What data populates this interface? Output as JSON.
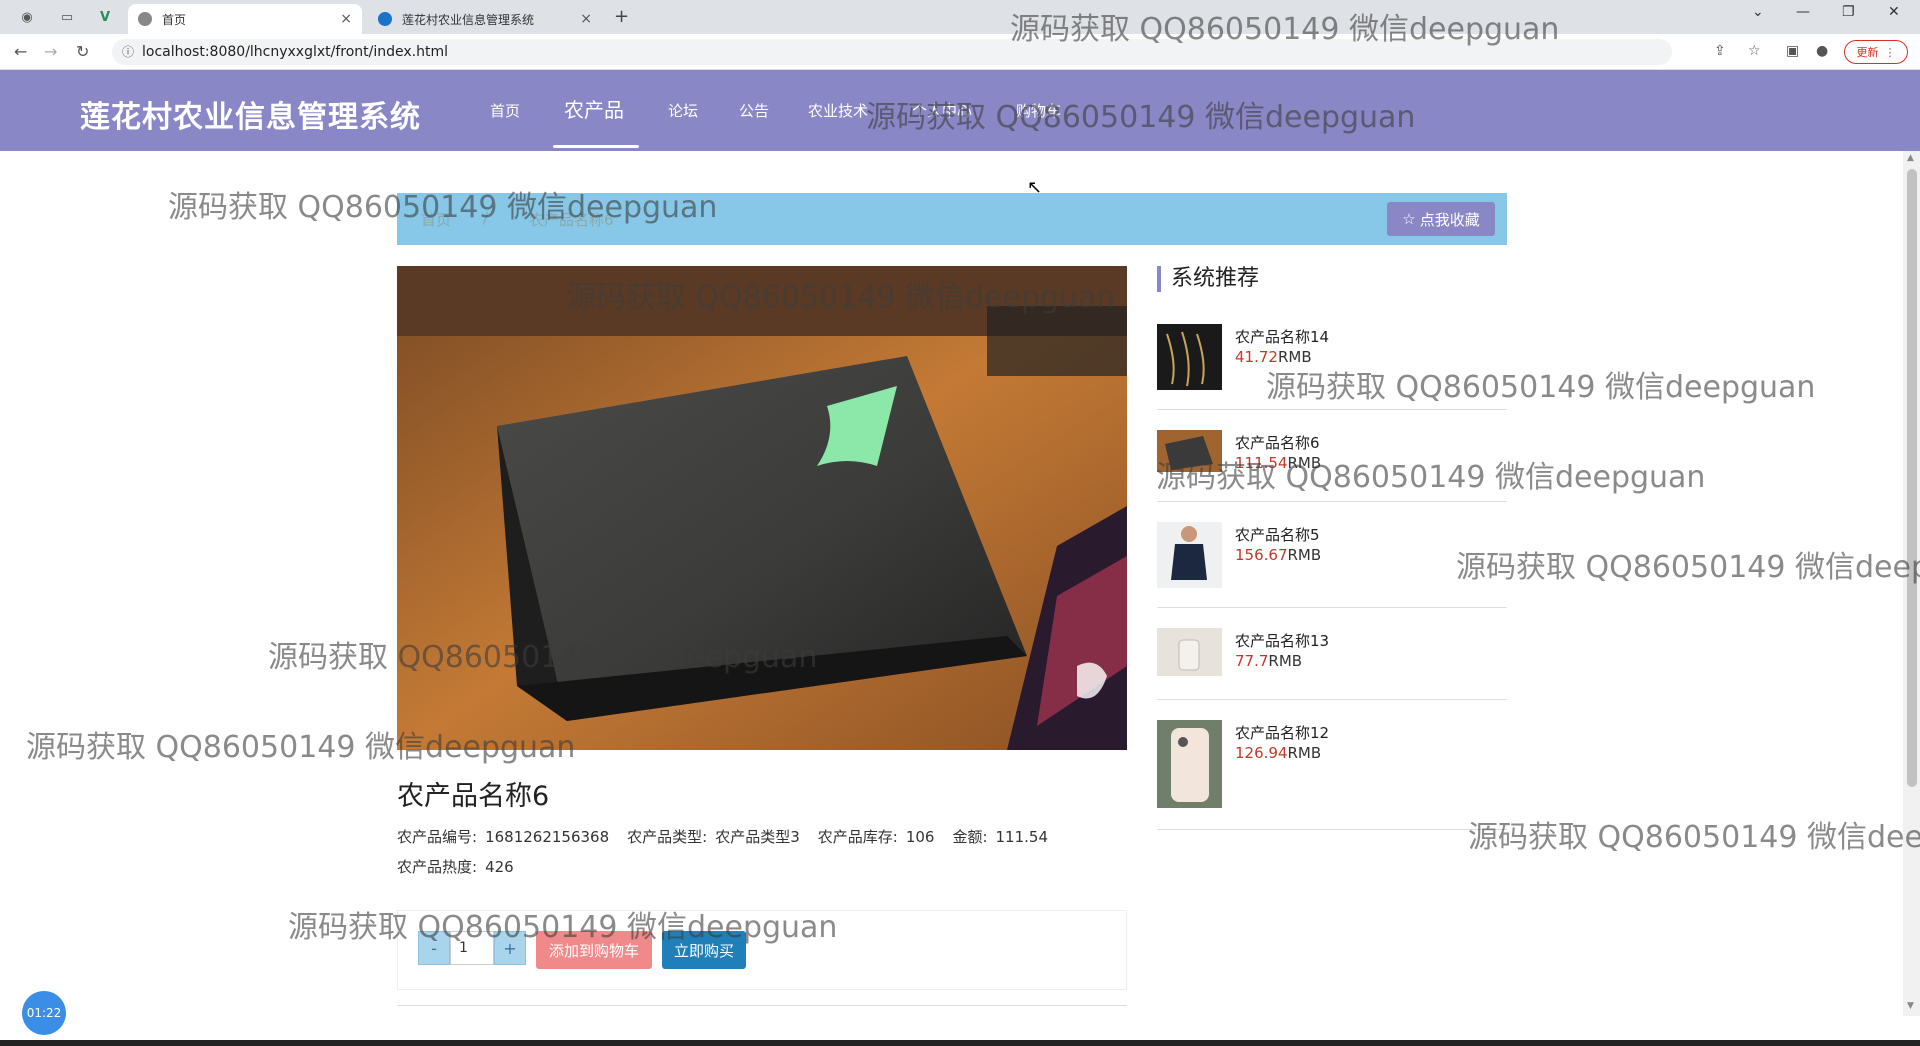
{
  "browser": {
    "tabs": [
      {
        "title": "首页",
        "close": "×"
      },
      {
        "title": "莲花村农业信息管理系统",
        "close": "×"
      }
    ],
    "new_tab": "+",
    "url": "localhost:8080/lhcnyxxglxt/front/index.html",
    "update_label": "更新",
    "window_controls": [
      "⌄",
      "—",
      "❐",
      "✕"
    ]
  },
  "site": {
    "brand": "莲花村农业信息管理系统",
    "nav": [
      "首页",
      "农产品",
      "论坛",
      "公告",
      "农业技术",
      "个人中心",
      "购物车"
    ],
    "active_nav": "农产品"
  },
  "breadcrumb": {
    "home": "首页",
    "separator": "/",
    "current": "农产品名称6",
    "favorite_label": "点我收藏"
  },
  "product": {
    "name": "农产品名称6",
    "fields": [
      {
        "label": "农产品编号:",
        "value": "1681262156368"
      },
      {
        "label": "农产品类型:",
        "value": "农产品类型3"
      },
      {
        "label": "农产品库存:",
        "value": "106"
      },
      {
        "label": "金额:",
        "value": "111.54"
      },
      {
        "label": "农产品热度:",
        "value": "426"
      }
    ],
    "qty_minus": "-",
    "qty_value": "1",
    "qty_plus": "+",
    "add_to_cart": "添加到购物车",
    "buy_now": "立即购买"
  },
  "recommend": {
    "title": "系统推荐",
    "items": [
      {
        "name": "农产品名称14",
        "price": "41.72",
        "unit": "RMB"
      },
      {
        "name": "农产品名称6",
        "price": "111.54",
        "unit": "RMB"
      },
      {
        "name": "农产品名称5",
        "price": "156.67",
        "unit": "RMB"
      },
      {
        "name": "农产品名称13",
        "price": "77.7",
        "unit": "RMB"
      },
      {
        "name": "农产品名称12",
        "price": "126.94",
        "unit": "RMB"
      }
    ]
  },
  "timer": "01:22",
  "watermark": "源码获取 QQ86050149 微信deepguan"
}
